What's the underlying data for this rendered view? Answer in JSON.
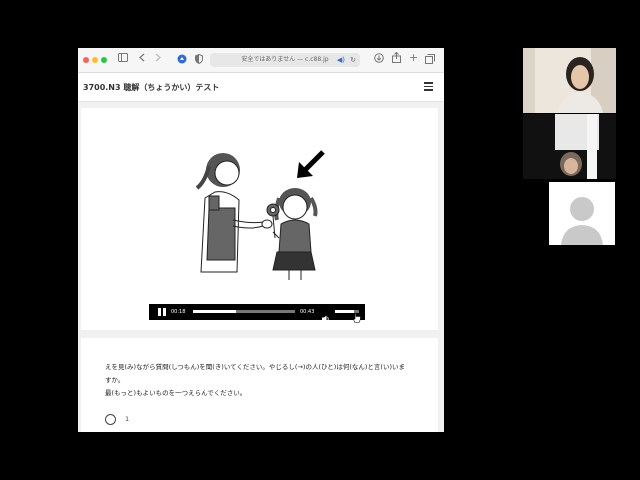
{
  "browser": {
    "address": "安全ではありません — c.c88.jp",
    "traffic_light_colors": [
      "#ff5f57",
      "#febc2e",
      "#28c840"
    ],
    "toolbar_icons": [
      "sidebar-icon",
      "back-icon",
      "forward-icon",
      "extension-icon",
      "shield-icon",
      "audio-icon",
      "reload-icon",
      "download-icon",
      "share-icon",
      "new-tab-icon",
      "tabs-icon"
    ]
  },
  "page": {
    "title": "3700.N3 聴解（ちょうかい）テスト"
  },
  "audio": {
    "current_time": "00:18",
    "duration": "00:43",
    "progress": 0.42,
    "volume": 0.8
  },
  "question": {
    "line1": "えを見(み)ながら質問(しつもん)を聞(き)いてください。やじるし(→)の人(ひと)は何(なん)と言(い)いま",
    "line2": "すか。",
    "line3": "最(もっと)もよいものを一つえらんでください。",
    "option1": "1"
  },
  "video_tiles": [
    "participant-1",
    "participant-2",
    "participant-3-placeholder"
  ]
}
